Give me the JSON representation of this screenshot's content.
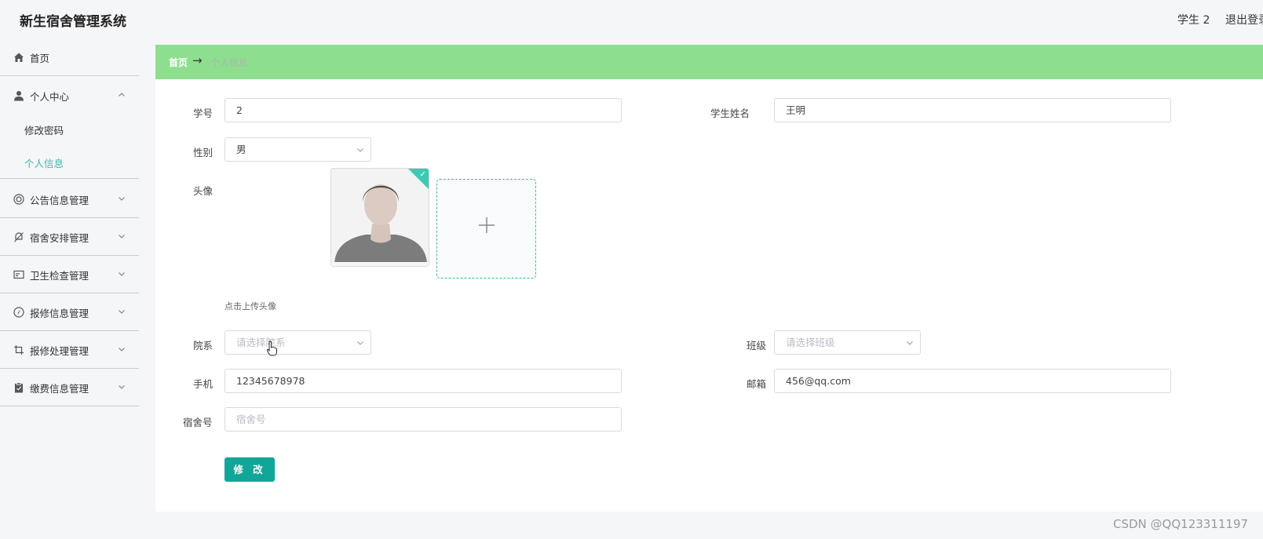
{
  "header": {
    "app_title": "新生宿舍管理系统",
    "user_name": "学生 2",
    "logout_label": "退出登录"
  },
  "sidebar": {
    "items": [
      {
        "label": "首页",
        "icon": "home-icon"
      },
      {
        "label": "个人中心",
        "icon": "user-icon",
        "expanded": true,
        "children": [
          {
            "label": "修改密码"
          },
          {
            "label": "个人信息",
            "active": true
          }
        ]
      },
      {
        "label": "公告信息管理",
        "icon": "announcement-icon"
      },
      {
        "label": "宿舍安排管理",
        "icon": "bell-off-icon"
      },
      {
        "label": "卫生检查管理",
        "icon": "card-icon"
      },
      {
        "label": "报修信息管理",
        "icon": "compass-icon"
      },
      {
        "label": "报修处理管理",
        "icon": "crop-icon"
      },
      {
        "label": "缴费信息管理",
        "icon": "clipboard-icon"
      }
    ]
  },
  "breadcrumb": {
    "home": "首页",
    "separator": "→",
    "current": "个人信息"
  },
  "form": {
    "student_no": {
      "label": "学号",
      "value": "2"
    },
    "student_name": {
      "label": "学生姓名",
      "value": "王明"
    },
    "gender": {
      "label": "性别",
      "value": "男"
    },
    "avatar": {
      "label": "头像",
      "hint": "点击上传头像"
    },
    "department": {
      "label": "院系",
      "placeholder": "请选择院系"
    },
    "class": {
      "label": "班级",
      "placeholder": "请选择班级"
    },
    "phone": {
      "label": "手机",
      "value": "12345678978"
    },
    "email": {
      "label": "邮箱",
      "value": "456@qq.com"
    },
    "dorm_no": {
      "label": "宿舍号",
      "placeholder": "宿舍号"
    },
    "submit_label": "修 改"
  },
  "colors": {
    "breadcrumb_bg": "#8ddf8f",
    "accent": "#3fb8a8",
    "button": "#11a697"
  },
  "watermark": "CSDN @QQ123311197"
}
